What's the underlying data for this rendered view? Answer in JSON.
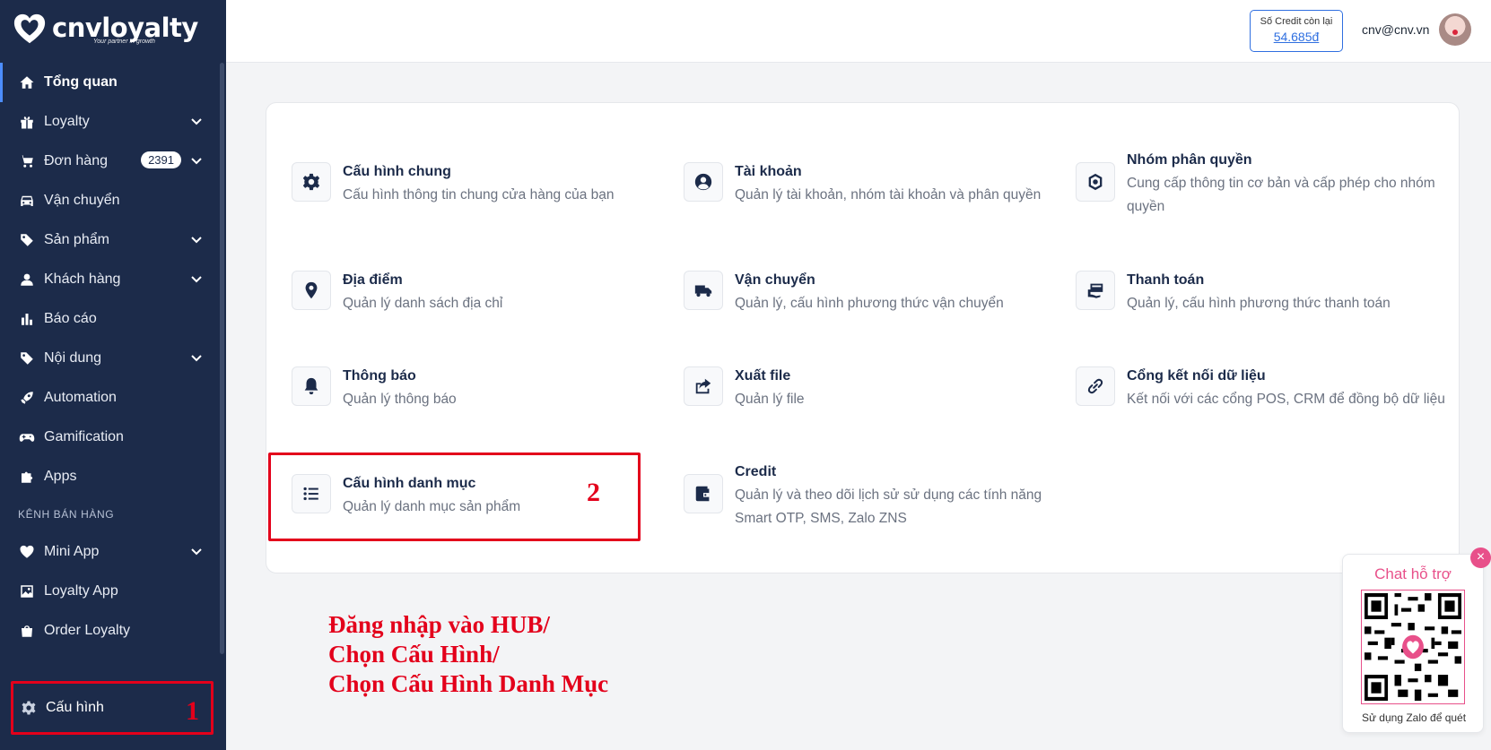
{
  "brand": {
    "name": "cnvloyalty",
    "tagline": "Your partner in growth"
  },
  "sidebar": {
    "items": [
      {
        "label": "Tổng quan",
        "icon": "home-icon"
      },
      {
        "label": "Loyalty",
        "icon": "gift-icon"
      },
      {
        "label": "Đơn hàng",
        "icon": "cart-icon",
        "badge": "2391"
      },
      {
        "label": "Vận chuyển",
        "icon": "car-icon"
      },
      {
        "label": "Sản phẩm",
        "icon": "tag-icon"
      },
      {
        "label": "Khách hàng",
        "icon": "person-icon"
      },
      {
        "label": "Báo cáo",
        "icon": "bar-chart-icon"
      },
      {
        "label": "Nội dung",
        "icon": "tag-icon"
      },
      {
        "label": "Automation",
        "icon": "rocket-icon"
      },
      {
        "label": "Gamification",
        "icon": "gamepad-icon"
      },
      {
        "label": "Apps",
        "icon": "puzzle-icon"
      }
    ],
    "section_label": "KÊNH BÁN HÀNG",
    "channel_items": [
      {
        "label": "Mini App",
        "icon": "heart-icon"
      },
      {
        "label": "Loyalty App",
        "icon": "image-icon"
      },
      {
        "label": "Order Loyalty",
        "icon": "bag-icon"
      }
    ],
    "settings_label": "Cấu hình",
    "settings_marker": "1"
  },
  "header": {
    "credit_label": "Số Credit còn lại",
    "credit_value": "54.685đ",
    "user_email": "cnv@cnv.vn"
  },
  "settings_tiles": [
    {
      "title": "Cấu hình chung",
      "desc": [
        "Cấu hình thông tin chung cửa hàng của bạn"
      ],
      "icon": "gear-icon"
    },
    {
      "title": "Tài khoản",
      "desc": [
        "Quản lý tài khoản, nhóm tài khoản và phân quyền"
      ],
      "icon": "user-circle-icon"
    },
    {
      "title": "Nhóm phân quyền",
      "desc": [
        "Cung cấp thông tin cơ bản và cấp phép cho nhóm",
        "quyền"
      ],
      "icon": "permission-icon"
    },
    {
      "title": "Địa điểm",
      "desc": [
        "Quản lý danh sách địa chỉ"
      ],
      "icon": "location-pin-icon"
    },
    {
      "title": "Vận chuyển",
      "desc": [
        "Quản lý, cấu hình phương thức vận chuyển"
      ],
      "icon": "truck-icon"
    },
    {
      "title": "Thanh toán",
      "desc": [
        "Quản lý, cấu hình phương thức thanh toán"
      ],
      "icon": "payment-icon"
    },
    {
      "title": "Thông báo",
      "desc": [
        "Quản lý thông báo"
      ],
      "icon": "bell-icon"
    },
    {
      "title": "Xuất file",
      "desc": [
        "Quản lý file"
      ],
      "icon": "export-icon"
    },
    {
      "title": "Cổng kết nối dữ liệu",
      "desc": [
        "Kết nối với các cổng POS, CRM để đồng bộ dữ liệu"
      ],
      "icon": "link-icon"
    },
    {
      "title": "Cấu hình danh mục",
      "desc": [
        "Quản lý danh mục sản phẩm"
      ],
      "icon": "list-icon"
    },
    {
      "title": "Credit",
      "desc": [
        "Quản lý và theo dõi lịch sử sử dụng các tính năng",
        "Smart OTP, SMS, Zalo ZNS"
      ],
      "icon": "wallet-icon"
    }
  ],
  "annotations": {
    "marker_2": "2",
    "instructions": [
      "Đăng nhập vào HUB/",
      "Chọn Cấu Hình/",
      "Chọn Cấu Hình Danh Mục"
    ]
  },
  "chat_widget": {
    "title": "Chat hỗ trợ",
    "caption": "Sử dụng Zalo để quét",
    "close_label": "×"
  },
  "colors": {
    "sidebar_bg": "#1c2b4a",
    "accent": "#2f6fe0",
    "highlight": "#e3001b",
    "chat": "#e8508a"
  }
}
